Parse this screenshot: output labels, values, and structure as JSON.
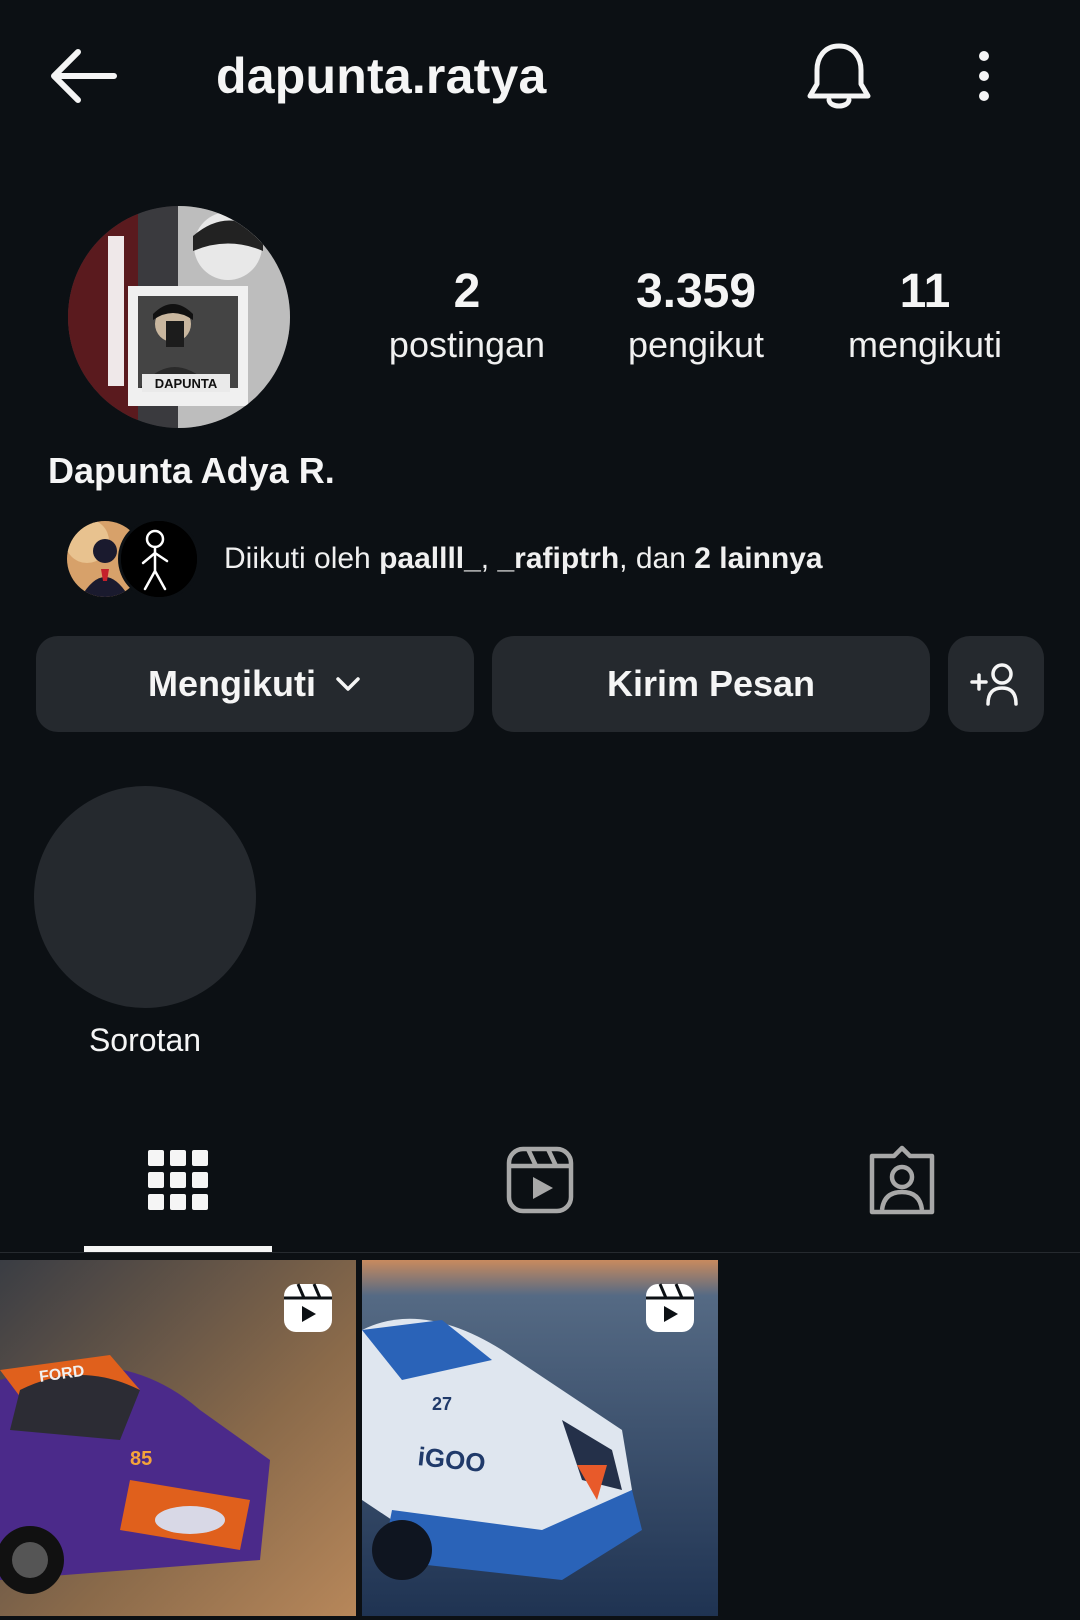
{
  "header": {
    "username": "dapunta.ratya",
    "back_icon": "arrow-left-icon",
    "bell_icon": "bell-icon",
    "more_icon": "more-vertical-icon"
  },
  "profile": {
    "full_name": "Dapunta Adya R.",
    "avatar_text": "DAPUNTA",
    "stats": [
      {
        "value": "2",
        "label": "postingan"
      },
      {
        "value": "3.359",
        "label": "pengikut"
      },
      {
        "value": "11",
        "label": "mengikuti"
      }
    ],
    "followed_by": {
      "prefix": "Diikuti oleh ",
      "user1": "paallll_",
      "sep": ", ",
      "user2": "_rafiptrh",
      "mid": ", dan ",
      "others": "2 lainnya"
    }
  },
  "actions": {
    "following_label": "Mengikuti",
    "message_label": "Kirim Pesan",
    "add_user_icon": "add-user-icon"
  },
  "highlights": [
    {
      "label": "Sorotan"
    }
  ],
  "tabs": [
    {
      "icon": "grid-icon",
      "active": true
    },
    {
      "icon": "reels-icon",
      "active": false
    },
    {
      "icon": "tagged-icon",
      "active": false
    }
  ],
  "posts": [
    {
      "kind": "reel",
      "car_text": "FORD",
      "number": "85"
    },
    {
      "kind": "reel",
      "car_text": "iGOO",
      "number": "27"
    }
  ],
  "colors": {
    "background": "#0c1014",
    "button": "#25292e",
    "text": "#f5f5f5"
  }
}
